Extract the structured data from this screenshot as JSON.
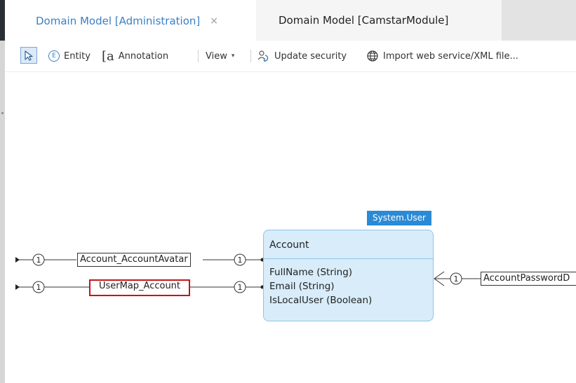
{
  "tabs": [
    {
      "label": "Domain Model [Administration]",
      "close": "×",
      "active": true
    },
    {
      "label": "Domain Model [CamstarModule]",
      "active": false
    }
  ],
  "toolbar": {
    "entity_label": "Entity",
    "entity_icon_letter": "E",
    "annotation_icon_letter": "a",
    "annotation_label": "Annotation",
    "view_label": "View",
    "view_caret": "▾",
    "update_security_label": "Update security",
    "import_label": "Import web service/XML file..."
  },
  "diagram": {
    "entity": {
      "module_tag": "System.User",
      "name": "Account",
      "attributes": [
        "FullName (String)",
        "Email (String)",
        "IsLocalUser (Boolean)"
      ]
    },
    "associations": [
      {
        "name": "Account_AccountAvatar",
        "multiplicity": "1",
        "selected": false
      },
      {
        "name": "UserMap_Account",
        "multiplicity": "1",
        "selected": true
      },
      {
        "name": "AccountPasswordD",
        "multiplicity": "1",
        "selected": false
      }
    ]
  },
  "colors": {
    "accent": "#3b7fc4",
    "entity_fill": "#d8ecf9",
    "entity_border": "#8ec4ea",
    "module_tag": "#2b8ad6",
    "selection": "#c0161c"
  }
}
